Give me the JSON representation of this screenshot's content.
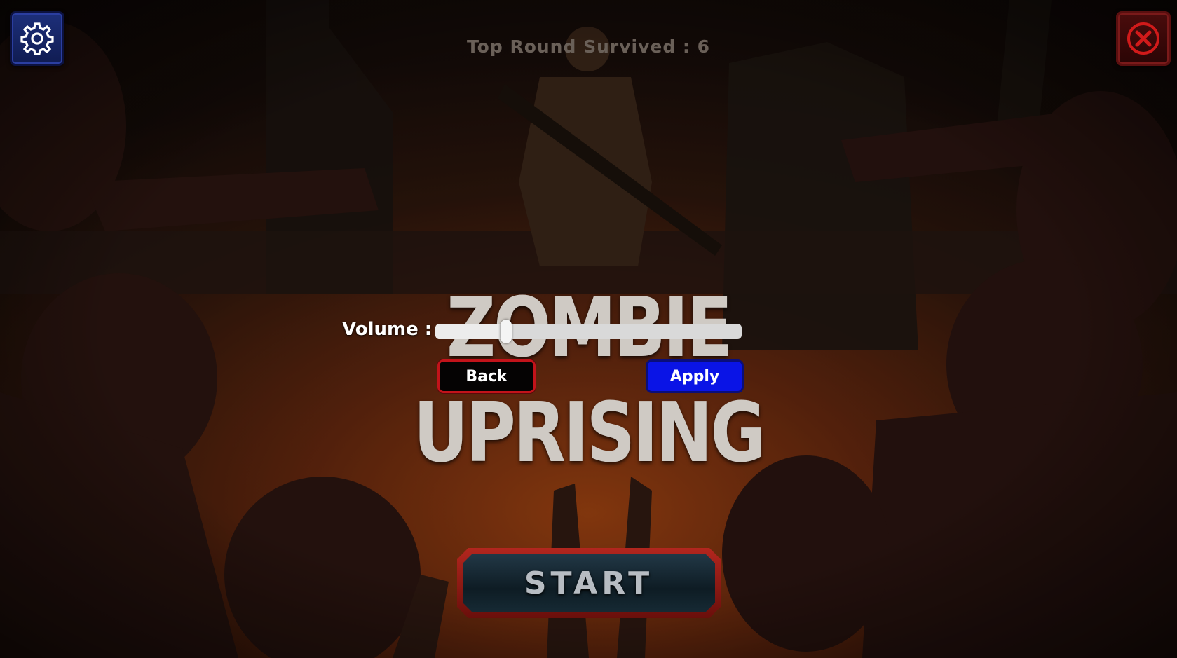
{
  "header": {
    "top_round_text": "Top Round Survived : 6"
  },
  "title": {
    "line1": "ZOMBIE",
    "line2": "UPRISING"
  },
  "settings_panel": {
    "volume_label": "Volume :",
    "volume_level": 0.23,
    "back_label": "Back",
    "apply_label": "Apply"
  },
  "start_label": "START",
  "icons": {
    "settings": "gear-icon",
    "close": "close-icon"
  },
  "colors": {
    "settings_button": "#1d2f7a",
    "close_button": "#4a0c0c",
    "back_border": "#c2131a",
    "apply_fill": "#0a14e6",
    "start_frame": "#b3261e"
  }
}
